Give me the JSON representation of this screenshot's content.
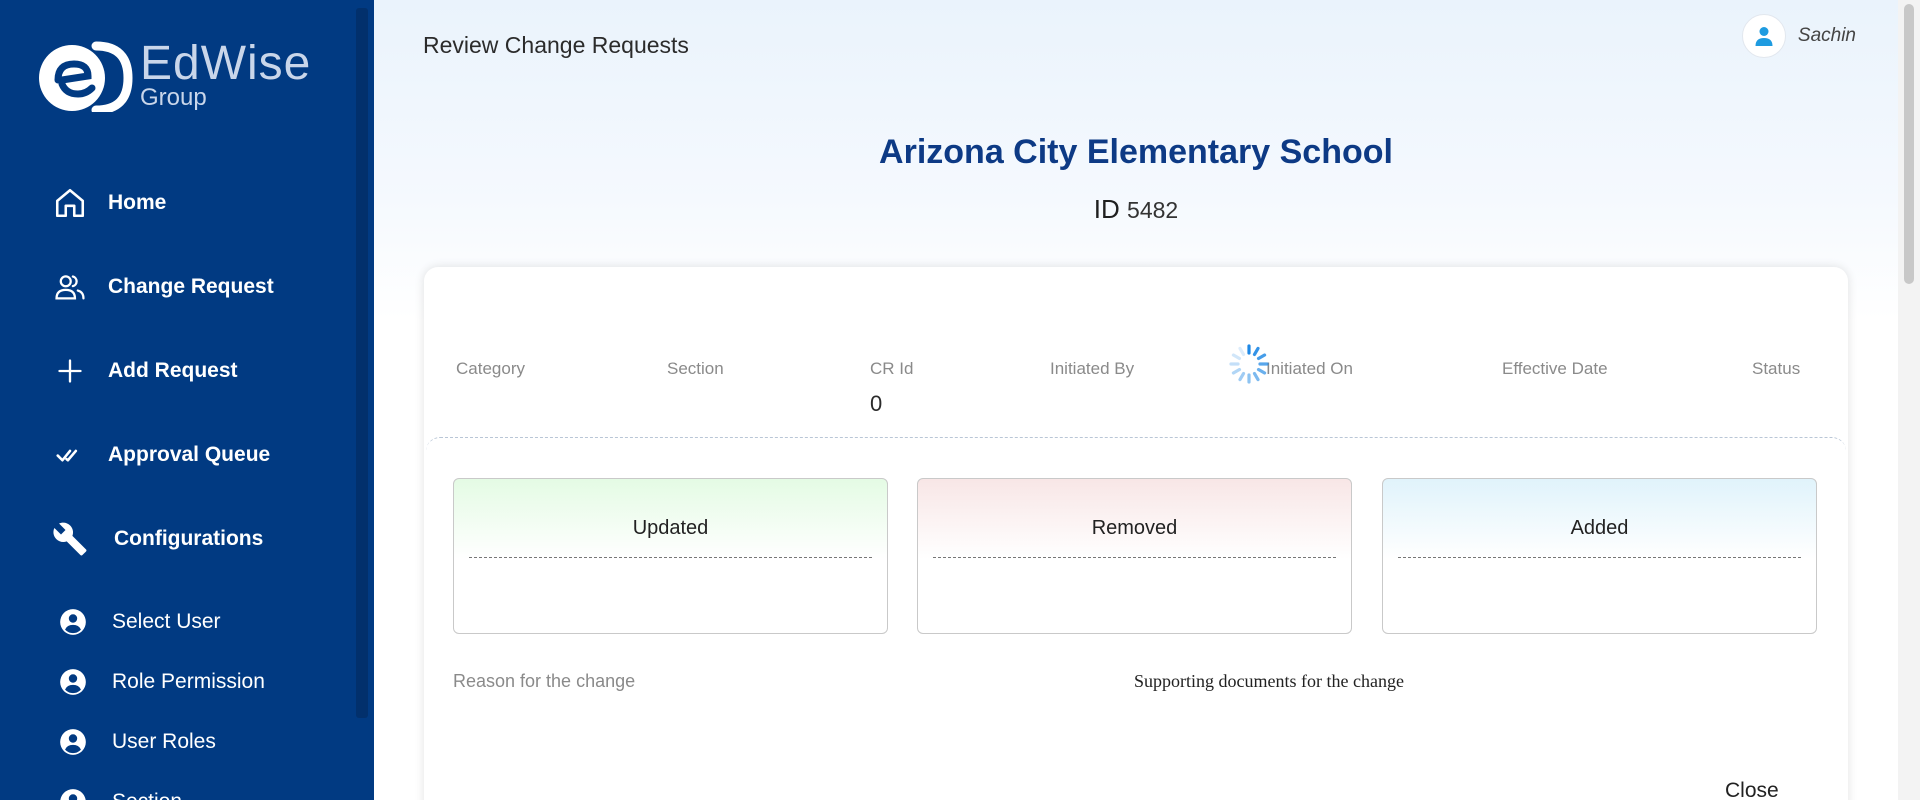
{
  "brand": {
    "word": "EdWise",
    "sub": "Group"
  },
  "sidebar": {
    "nav": [
      {
        "label": "Home",
        "icon": "home-icon"
      },
      {
        "label": "Change Request",
        "icon": "users-icon"
      },
      {
        "label": "Add Request",
        "icon": "plus-icon"
      },
      {
        "label": "Approval Queue",
        "icon": "double-check-icon"
      },
      {
        "label": "Configurations",
        "icon": "wrench-icon"
      }
    ],
    "sub": [
      {
        "label": "Select User",
        "icon": "account-circle-icon"
      },
      {
        "label": "Role Permission",
        "icon": "account-circle-icon"
      },
      {
        "label": "User Roles",
        "icon": "account-circle-icon"
      },
      {
        "label": "Section",
        "icon": "account-circle-icon"
      }
    ]
  },
  "header": {
    "title": "Review Change Requests",
    "user": "Sachin"
  },
  "school": {
    "name": "Arizona City Elementary School",
    "id_label": "ID",
    "id_value": "5482"
  },
  "summary": {
    "columns": [
      {
        "label": "Category",
        "value": ""
      },
      {
        "label": "Section",
        "value": ""
      },
      {
        "label": "CR Id",
        "value": "0"
      },
      {
        "label": "Initiated By",
        "value": ""
      },
      {
        "label": "Initiated On",
        "value": ""
      },
      {
        "label": "Effective Date",
        "value": ""
      },
      {
        "label": "Status",
        "value": ""
      }
    ]
  },
  "boxes": {
    "updated": "Updated",
    "removed": "Removed",
    "added": "Added"
  },
  "labels": {
    "reason": "Reason for the change",
    "supporting": "Supporting documents for the change",
    "close": "Close"
  },
  "colors": {
    "sidebar_bg": "#013a82",
    "school_title": "#0d3a85",
    "updated_tint": "#e4fbe4",
    "removed_tint": "#f8e6e6",
    "added_tint": "#e0f3fb",
    "avatar_accent": "#1e9be0"
  }
}
